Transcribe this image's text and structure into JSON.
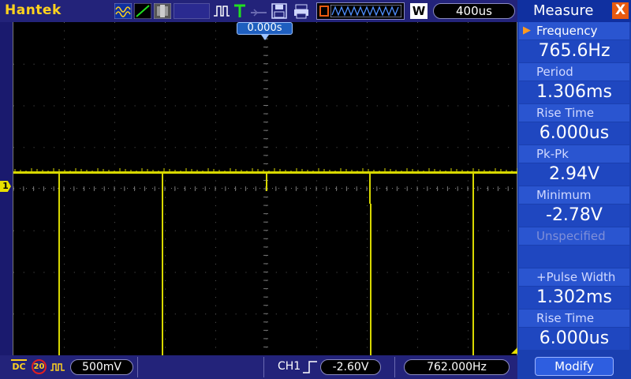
{
  "brand": "Hantek",
  "toolbar": {
    "run_mode_label": "W",
    "timebase": "400us"
  },
  "screen": {
    "trigger_time": "0.000s",
    "channel_marker": "1"
  },
  "status": {
    "coupling": "DC",
    "bandwidth_limit": "20",
    "ch1_volts_div": "500mV",
    "trigger_source": "CH1",
    "trigger_level": "-2.60V",
    "trigger_frequency": "762.000Hz"
  },
  "measure": {
    "title": "Measure",
    "close_symbol": "X",
    "items": [
      {
        "label": "Frequency",
        "value": "765.6Hz"
      },
      {
        "label": "Period",
        "value": "1.306ms"
      },
      {
        "label": "Rise Time",
        "value": "6.000us"
      },
      {
        "label": "Pk-Pk",
        "value": "2.94V"
      },
      {
        "label": "Minimum",
        "value": "-2.78V"
      },
      {
        "label": "Unspecified",
        "value": ""
      },
      {
        "label": "+Pulse Width",
        "value": "1.302ms"
      },
      {
        "label": "Rise Time",
        "value": "6.000us"
      }
    ],
    "modify_label": "Modify"
  },
  "colors": {
    "trace": "#d8d800",
    "panel": "#1a3fb0",
    "brand": "#ffd21e",
    "accent": "#e85a10"
  }
}
